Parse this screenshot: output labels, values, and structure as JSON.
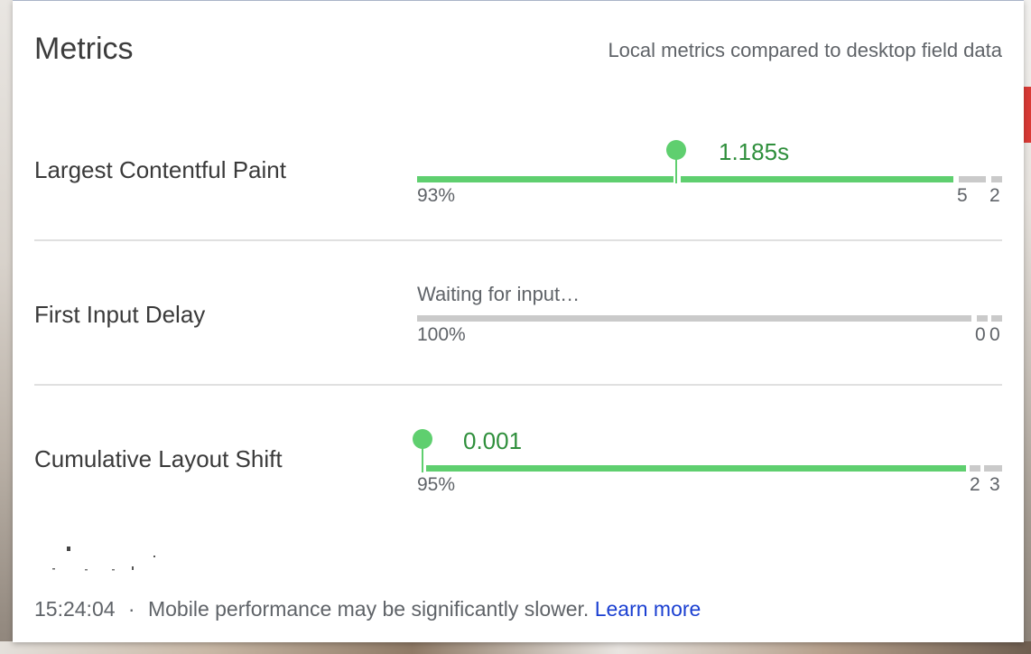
{
  "header": {
    "title": "Metrics",
    "subtitle": "Local metrics compared to desktop field data"
  },
  "metrics": [
    {
      "label": "Largest Contentful Paint",
      "value": "1.185s",
      "marker_fraction": 0.475,
      "distribution": {
        "good": "93%",
        "needs_improvement": "5",
        "poor": "2"
      },
      "bar_fractions": {
        "good": 0.93,
        "needs_improvement": 0.05,
        "poor": 0.02
      }
    },
    {
      "label": "First Input Delay",
      "status": "Waiting for input…",
      "distribution": {
        "good": "100%",
        "needs_improvement": "0",
        "poor": "0"
      },
      "bar_fractions": {
        "good": 1.0,
        "needs_improvement": 0.0,
        "poor": 0.0
      }
    },
    {
      "label": "Cumulative Layout Shift",
      "value": "0.001",
      "marker_fraction": 0.01,
      "distribution": {
        "good": "95%",
        "needs_improvement": "2",
        "poor": "3"
      },
      "bar_fractions": {
        "good": 0.95,
        "needs_improvement": 0.02,
        "poor": 0.03
      }
    }
  ],
  "footer": {
    "time": "15:24:04",
    "separator": "·",
    "message": "Mobile performance may be significantly slower.",
    "link": "Learn more"
  },
  "colors": {
    "good": "#5fcf6f",
    "unknown": "#cacaca",
    "value_text": "#2f8f3c",
    "link": "#1a3fd1"
  }
}
